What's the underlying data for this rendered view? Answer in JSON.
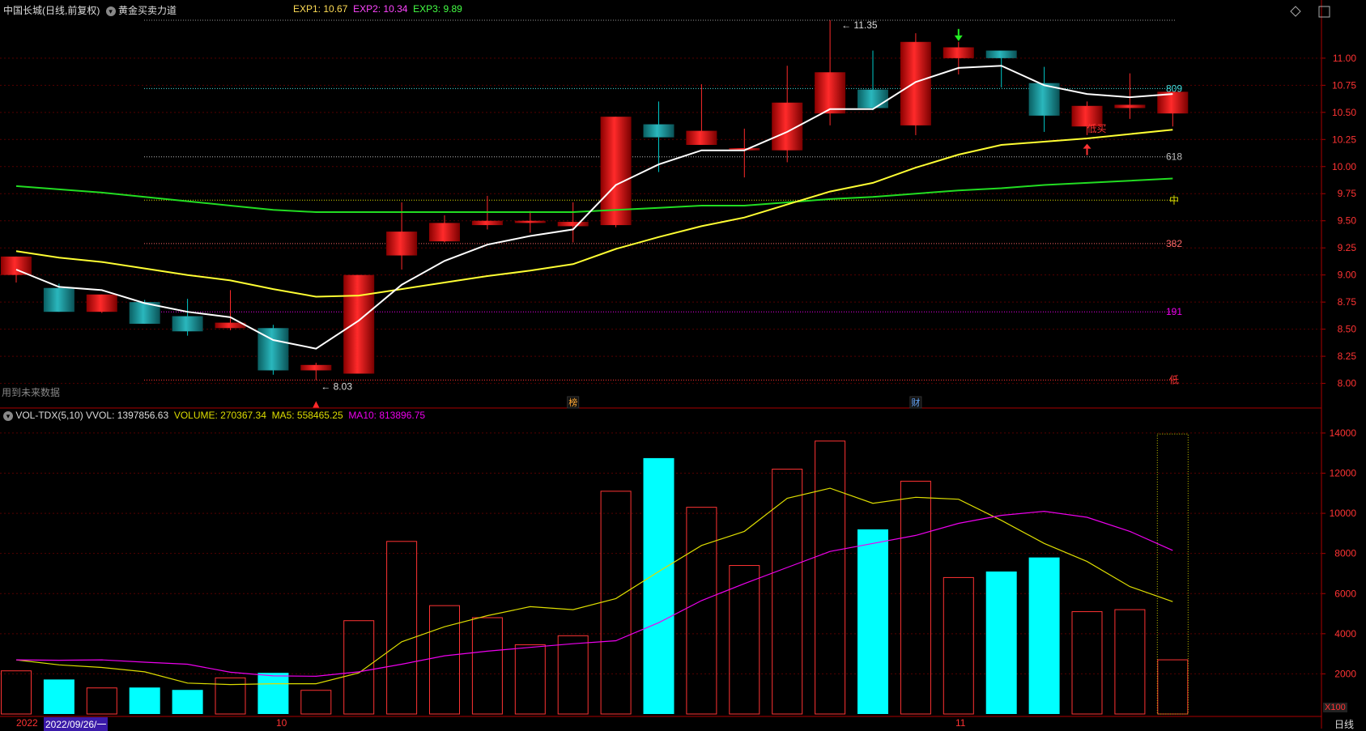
{
  "header": {
    "stock_title": "中国长城(日线,前复权)",
    "indicator_name": "黄金买卖力道",
    "exp1_label": "EXP1: 10.67",
    "exp2_label": "EXP2: 10.34",
    "exp3_label": "EXP3: 9.89",
    "future_data_note": "用到未来数据"
  },
  "volume_header": {
    "name": "VOL-TDX(5,10)",
    "vvol": "VVOL: 1397856.63",
    "volume": "VOLUME: 270367.34",
    "ma5": "MA5: 558465.25",
    "ma10": "MA10: 813896.75"
  },
  "colors": {
    "up": "#ff2a2a",
    "down": "#00c8c8",
    "vol_down": "#00ffff",
    "exp1": "#ffffff",
    "exp2": "#ffff33",
    "exp3": "#22dd22",
    "ma5": "#dddd00",
    "ma10": "#ee00ee",
    "axis": "#aa0000"
  },
  "bottom_axis": {
    "year_label": "2022",
    "date_label": "2022/09/26/一",
    "month_10": "10",
    "month_11": "11",
    "period_label": "日线",
    "vol_unit": "X100"
  },
  "markers": {
    "bang": "榜",
    "cai": "财",
    "buy_label": "低买"
  },
  "chart_data": [
    {
      "type": "candlestick",
      "title": "中国长城(日线,前复权)",
      "y_ticks": [
        "8.00",
        "8.25",
        "8.50",
        "8.75",
        "9.00",
        "9.25",
        "9.50",
        "9.75",
        "10.00",
        "10.25",
        "10.50",
        "10.75",
        "11.00"
      ],
      "ylim": [
        7.84,
        11.35
      ],
      "high_label": "11.35",
      "low_label": "8.03",
      "candles": [
        {
          "o": 9.0,
          "h": 9.17,
          "l": 8.93,
          "c": 9.17
        },
        {
          "o": 8.88,
          "h": 8.92,
          "l": 8.66,
          "c": 8.66
        },
        {
          "o": 8.66,
          "h": 8.82,
          "l": 8.65,
          "c": 8.82
        },
        {
          "o": 8.75,
          "h": 8.77,
          "l": 8.55,
          "c": 8.55
        },
        {
          "o": 8.62,
          "h": 8.78,
          "l": 8.44,
          "c": 8.48
        },
        {
          "o": 8.51,
          "h": 8.86,
          "l": 8.49,
          "c": 8.56
        },
        {
          "o": 8.51,
          "h": 8.54,
          "l": 8.08,
          "c": 8.12
        },
        {
          "o": 8.12,
          "h": 8.19,
          "l": 8.03,
          "c": 8.17
        },
        {
          "o": 8.09,
          "h": 9.0,
          "l": 8.09,
          "c": 9.0
        },
        {
          "o": 9.18,
          "h": 9.67,
          "l": 9.05,
          "c": 9.4
        },
        {
          "o": 9.31,
          "h": 9.55,
          "l": 9.3,
          "c": 9.48
        },
        {
          "o": 9.46,
          "h": 9.73,
          "l": 9.42,
          "c": 9.5
        },
        {
          "o": 9.48,
          "h": 9.59,
          "l": 9.39,
          "c": 9.5
        },
        {
          "o": 9.45,
          "h": 9.67,
          "l": 9.3,
          "c": 9.49
        },
        {
          "o": 9.46,
          "h": 10.46,
          "l": 9.44,
          "c": 10.46
        },
        {
          "o": 10.39,
          "h": 10.6,
          "l": 9.95,
          "c": 10.27
        },
        {
          "o": 10.2,
          "h": 10.76,
          "l": 10.2,
          "c": 10.33
        },
        {
          "o": 10.15,
          "h": 10.35,
          "l": 9.9,
          "c": 10.17
        },
        {
          "o": 10.15,
          "h": 10.93,
          "l": 10.04,
          "c": 10.59
        },
        {
          "o": 10.49,
          "h": 11.35,
          "l": 10.38,
          "c": 10.87
        },
        {
          "o": 10.71,
          "h": 11.07,
          "l": 10.52,
          "c": 10.54
        },
        {
          "o": 10.38,
          "h": 11.23,
          "l": 10.29,
          "c": 11.15
        },
        {
          "o": 11.0,
          "h": 11.15,
          "l": 10.85,
          "c": 11.1
        },
        {
          "o": 11.07,
          "h": 11.07,
          "l": 10.73,
          "c": 11.0
        },
        {
          "o": 10.77,
          "h": 10.92,
          "l": 10.32,
          "c": 10.47
        },
        {
          "o": 10.37,
          "h": 10.6,
          "l": 10.29,
          "c": 10.56
        },
        {
          "o": 10.54,
          "h": 10.86,
          "l": 10.44,
          "c": 10.57
        },
        {
          "o": 10.49,
          "h": 10.69,
          "l": 10.37,
          "c": 10.69
        }
      ],
      "exp1": [
        9.05,
        8.89,
        8.86,
        8.74,
        8.66,
        8.61,
        8.4,
        8.32,
        8.58,
        8.91,
        9.13,
        9.28,
        9.36,
        9.42,
        9.83,
        10.02,
        10.15,
        10.15,
        10.32,
        10.53,
        10.53,
        10.78,
        10.91,
        10.93,
        10.75,
        10.67,
        10.64,
        10.67
      ],
      "exp2": [
        9.22,
        9.16,
        9.12,
        9.06,
        9.0,
        8.95,
        8.87,
        8.8,
        8.81,
        8.87,
        8.93,
        8.99,
        9.04,
        9.1,
        9.24,
        9.35,
        9.45,
        9.53,
        9.65,
        9.77,
        9.85,
        9.99,
        10.11,
        10.2,
        10.23,
        10.26,
        10.3,
        10.34
      ],
      "exp3": [
        9.82,
        9.79,
        9.76,
        9.72,
        9.68,
        9.64,
        9.6,
        9.58,
        9.58,
        9.58,
        9.58,
        9.58,
        9.58,
        9.58,
        9.6,
        9.62,
        9.64,
        9.64,
        9.67,
        9.7,
        9.72,
        9.75,
        9.78,
        9.8,
        9.83,
        9.85,
        9.87,
        9.89
      ],
      "levels": [
        {
          "label": "",
          "price": 11.35,
          "color": "#9a9a9a"
        },
        {
          "label": "809",
          "price": 10.72,
          "color": "#44dddd"
        },
        {
          "label": "618",
          "price": 10.09,
          "color": "#bbbbbb"
        },
        {
          "label": "中",
          "price": 9.69,
          "color": "#dddd00"
        },
        {
          "label": "382",
          "price": 9.29,
          "color": "#ff6666"
        },
        {
          "label": "191",
          "price": 8.66,
          "color": "#ee00ee"
        },
        {
          "label": "低",
          "price": 8.03,
          "color": "#ff3333"
        }
      ]
    },
    {
      "type": "bar",
      "title": "VOL-TDX(5,10)",
      "unit": "X100",
      "y_ticks": [
        "2000",
        "4000",
        "6000",
        "8000",
        "10000",
        "12000",
        "14000"
      ],
      "ylim": [
        0,
        14400
      ],
      "volumes": [
        2150,
        1720,
        1300,
        1320,
        1200,
        1800,
        2050,
        1180,
        4650,
        8600,
        5400,
        4800,
        3450,
        3900,
        11100,
        12750,
        10300,
        7400,
        12200,
        13600,
        9200,
        11600,
        6800,
        7100,
        7800,
        5100,
        5200,
        2700
      ],
      "ma5": [
        2700,
        2450,
        2320,
        2100,
        1540,
        1470,
        1510,
        1510,
        2050,
        3600,
        4350,
        4900,
        5350,
        5200,
        5750,
        7100,
        8400,
        9100,
        10750,
        11250,
        10500,
        10800,
        10700,
        9650,
        8500,
        7600,
        6350,
        5600
      ],
      "ma10": [
        2700,
        2680,
        2700,
        2580,
        2480,
        2080,
        1900,
        1880,
        2100,
        2480,
        2900,
        3130,
        3320,
        3500,
        3650,
        4550,
        5650,
        6500,
        7300,
        8100,
        8500,
        8900,
        9500,
        9900,
        10100,
        9800,
        9100,
        8150
      ]
    }
  ]
}
